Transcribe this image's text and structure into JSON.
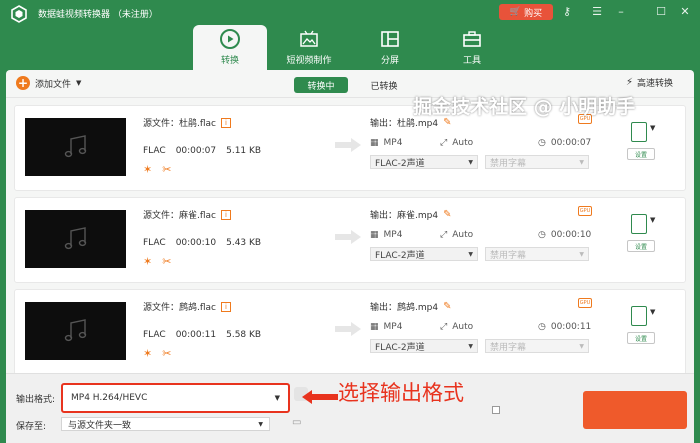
{
  "app": {
    "title": "数据蛙视频转换器 （未注册）",
    "buy_label": "购买",
    "window_icons": [
      "key-icon",
      "menu-icon",
      "minimize-icon",
      "maximize-icon",
      "close-icon"
    ]
  },
  "tabs": [
    {
      "label": "转换",
      "icon": "convert-icon",
      "active": true
    },
    {
      "label": "短视频制作",
      "icon": "video-maker-icon",
      "active": false
    },
    {
      "label": "分屏",
      "icon": "split-screen-icon",
      "active": false
    },
    {
      "label": "工具",
      "icon": "toolbox-icon",
      "active": false
    }
  ],
  "toolbar": {
    "add_file": "添加文件",
    "converting": "转换中",
    "converted": "已转换",
    "high_speed": "高速转换"
  },
  "files": [
    {
      "source_label": "源文件：杜鹃.flac",
      "codec": "FLAC",
      "duration": "00:00:07",
      "size": "5.11 KB",
      "output_label": "输出：杜鹃.mp4",
      "out_format": "MP4",
      "resolution": "Auto",
      "out_duration": "00:00:07",
      "audio": "FLAC-2声道",
      "subtitle": "禁用字幕",
      "settings": "设置"
    },
    {
      "source_label": "源文件：麻雀.flac",
      "codec": "FLAC",
      "duration": "00:00:10",
      "size": "5.43 KB",
      "output_label": "输出：麻雀.mp4",
      "out_format": "MP4",
      "resolution": "Auto",
      "out_duration": "00:00:10",
      "audio": "FLAC-2声道",
      "subtitle": "禁用字幕",
      "settings": "设置"
    },
    {
      "source_label": "源文件：鹧鸪.flac",
      "codec": "FLAC",
      "duration": "00:00:11",
      "size": "5.58 KB",
      "output_label": "输出：鹧鸪.mp4",
      "out_format": "MP4",
      "resolution": "Auto",
      "out_duration": "00:00:11",
      "audio": "FLAC-2声道",
      "subtitle": "禁用字幕",
      "settings": "设置"
    }
  ],
  "bottom": {
    "output_format_label": "输出格式:",
    "output_format_value": "MP4 H.264/HEVC",
    "save_to_label": "保存至:",
    "save_to_value": "与源文件夹一致",
    "annotation": "选择输出格式"
  },
  "watermark": "掘金技术社区 @ 小明助手",
  "colors": {
    "brand_green": "#2f8a4e",
    "accent_orange": "#ef7a1e",
    "highlight_red": "#e8331e"
  }
}
